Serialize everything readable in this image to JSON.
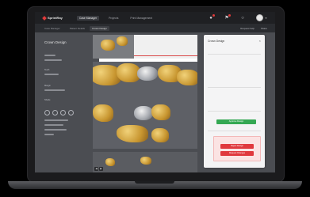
{
  "app": {
    "name": "SprintRay"
  },
  "nav": {
    "tabs": [
      {
        "label": "Case Manager"
      },
      {
        "label": "Projects"
      },
      {
        "label": "Print Management"
      }
    ]
  },
  "breadcrumb": {
    "items": [
      {
        "label": "Case Manager"
      },
      {
        "label": "Patient Details"
      },
      {
        "label": "Crown Design"
      }
    ],
    "actions": [
      {
        "label": "Request help"
      },
      {
        "label": "Share"
      }
    ]
  },
  "sidebar": {
    "title": "Crown Design",
    "subtitle": "",
    "labels": [
      "Teeth",
      "Margin",
      "Shade"
    ]
  },
  "panel": {
    "title": "Crown Design",
    "subtitle1": "",
    "subtitle2": "",
    "rows": [
      {
        "key": "",
        "value": ""
      },
      {
        "key": "",
        "value": ""
      },
      {
        "key": "",
        "value": ""
      },
      {
        "key": "",
        "value": ""
      },
      {
        "key": "",
        "value": ""
      },
      {
        "key": "",
        "value": ""
      }
    ],
    "primary_button": "Approve Design",
    "warning_text": "",
    "danger_buttons": [
      "Reject Design",
      "Request Changes"
    ]
  },
  "colors": {
    "accent_red": "#e03a3a",
    "approve_green": "#34a853",
    "danger_red": "#e0393e"
  },
  "icons": [
    "bell-icon",
    "flag-icon",
    "help-icon",
    "user-avatar",
    "chevron-down-icon",
    "close-icon"
  ]
}
